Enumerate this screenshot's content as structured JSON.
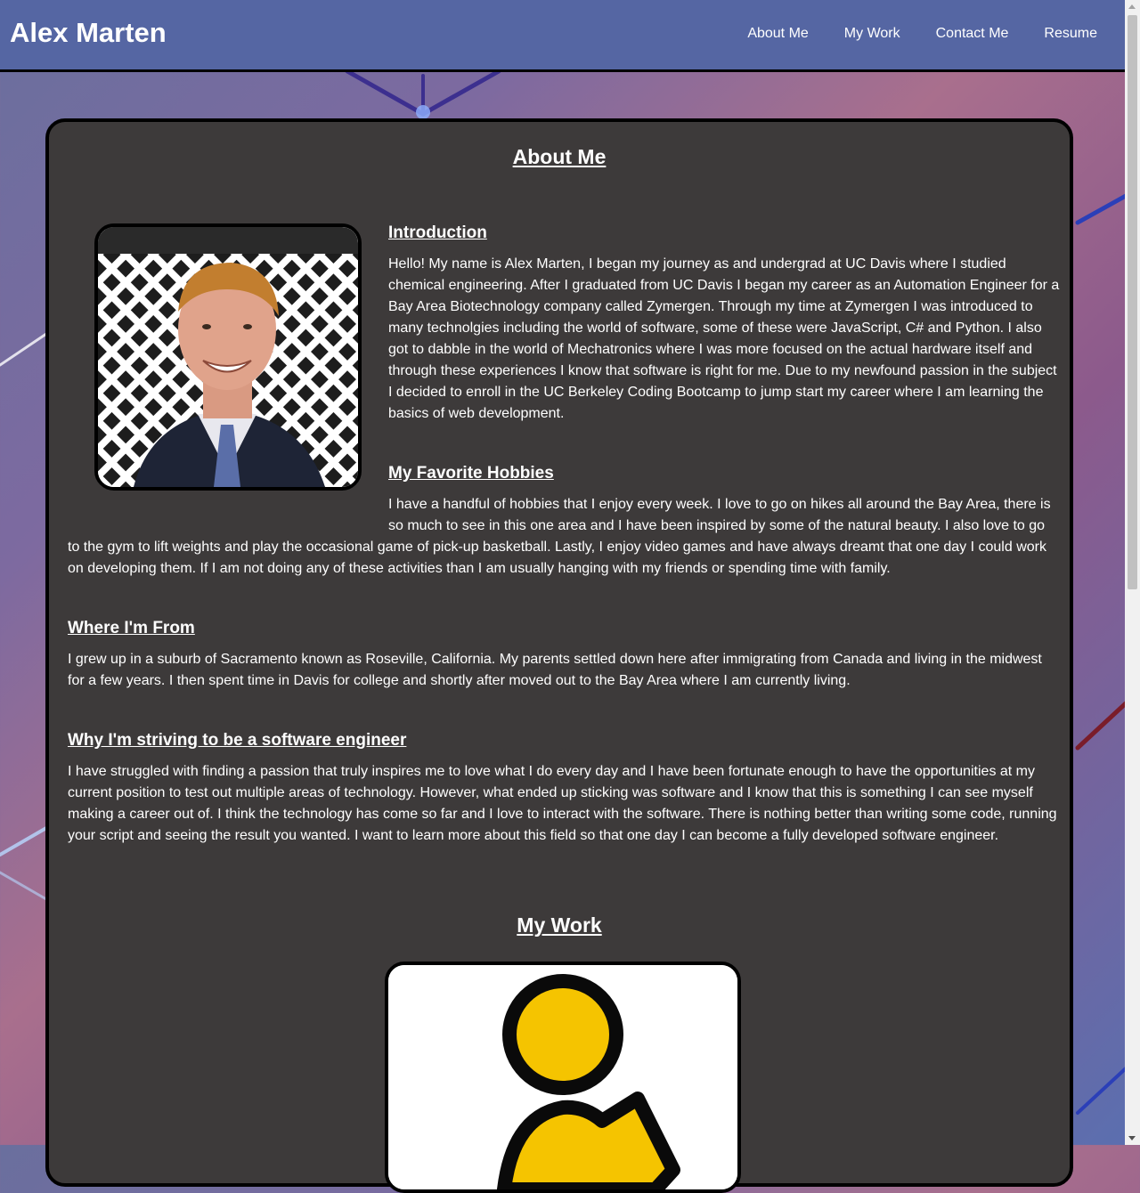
{
  "header": {
    "brand": "Alex Marten",
    "nav": [
      "About Me",
      "My Work",
      "Contact Me",
      "Resume"
    ]
  },
  "about": {
    "title": "About Me",
    "introduction": {
      "heading": "Introduction",
      "text": "Hello! My name is Alex Marten, I began my journey as and undergrad at UC Davis where I studied chemical engineering. After I graduated from UC Davis I began my career as an Automation Engineer for a Bay Area Biotechnology company called Zymergen. Through my time at Zymergen I was introduced to many technolgies including the world of software, some of these were JavaScript, C# and Python. I also got to dabble in the world of Mechatronics where I was more focused on the actual hardware itself and through these experiences I know that software is right for me. Due to my newfound passion in the subject I decided to enroll in the UC Berkeley Coding Bootcamp to jump start my career where I am learning the basics of web development."
    },
    "hobbies": {
      "heading": "My Favorite Hobbies",
      "line1": "I have a handful of hobbies that I enjoy every week. I love to go on hikes all around the Bay Area, there is",
      "line2": "so much to see in this one area and I have been inspired by some of the natural beauty. I also love to go",
      "rest": "to the gym to lift weights and play the occasional game of pick-up basketball. Lastly, I enjoy video games and have always dreamt that one day I could work on developing them. If I am not doing any of these activities than I am usually hanging with my friends or spending time with family."
    },
    "from": {
      "heading": "Where I'm From",
      "text": "I grew up in a suburb of Sacramento known as Roseville, California. My parents settled down here after immigrating from Canada and living in the midwest for a few years. I then spent time in Davis for college and shortly after moved out to the Bay Area where I am currently living."
    },
    "why": {
      "heading": "Why I'm striving to be a software engineer",
      "text": "I have struggled with finding a passion that truly inspires me to love what I do every day and I have been fortunate enough to have the opportunities at my current position to test out multiple areas of technology. However, what ended up sticking was software and I know that this is something I can see myself making a career out of. I think the technology has come so far and I love to interact with the software. There is nothing better than writing some code, running your script and seeing the result you wanted. I want to learn more about this field so that one day I can become a fully developed software engineer."
    }
  },
  "work": {
    "title": "My Work"
  },
  "colors": {
    "header_bg": "#5566a3",
    "card_bg": "#3d3a3a",
    "logo_yellow": "#f5c400"
  }
}
